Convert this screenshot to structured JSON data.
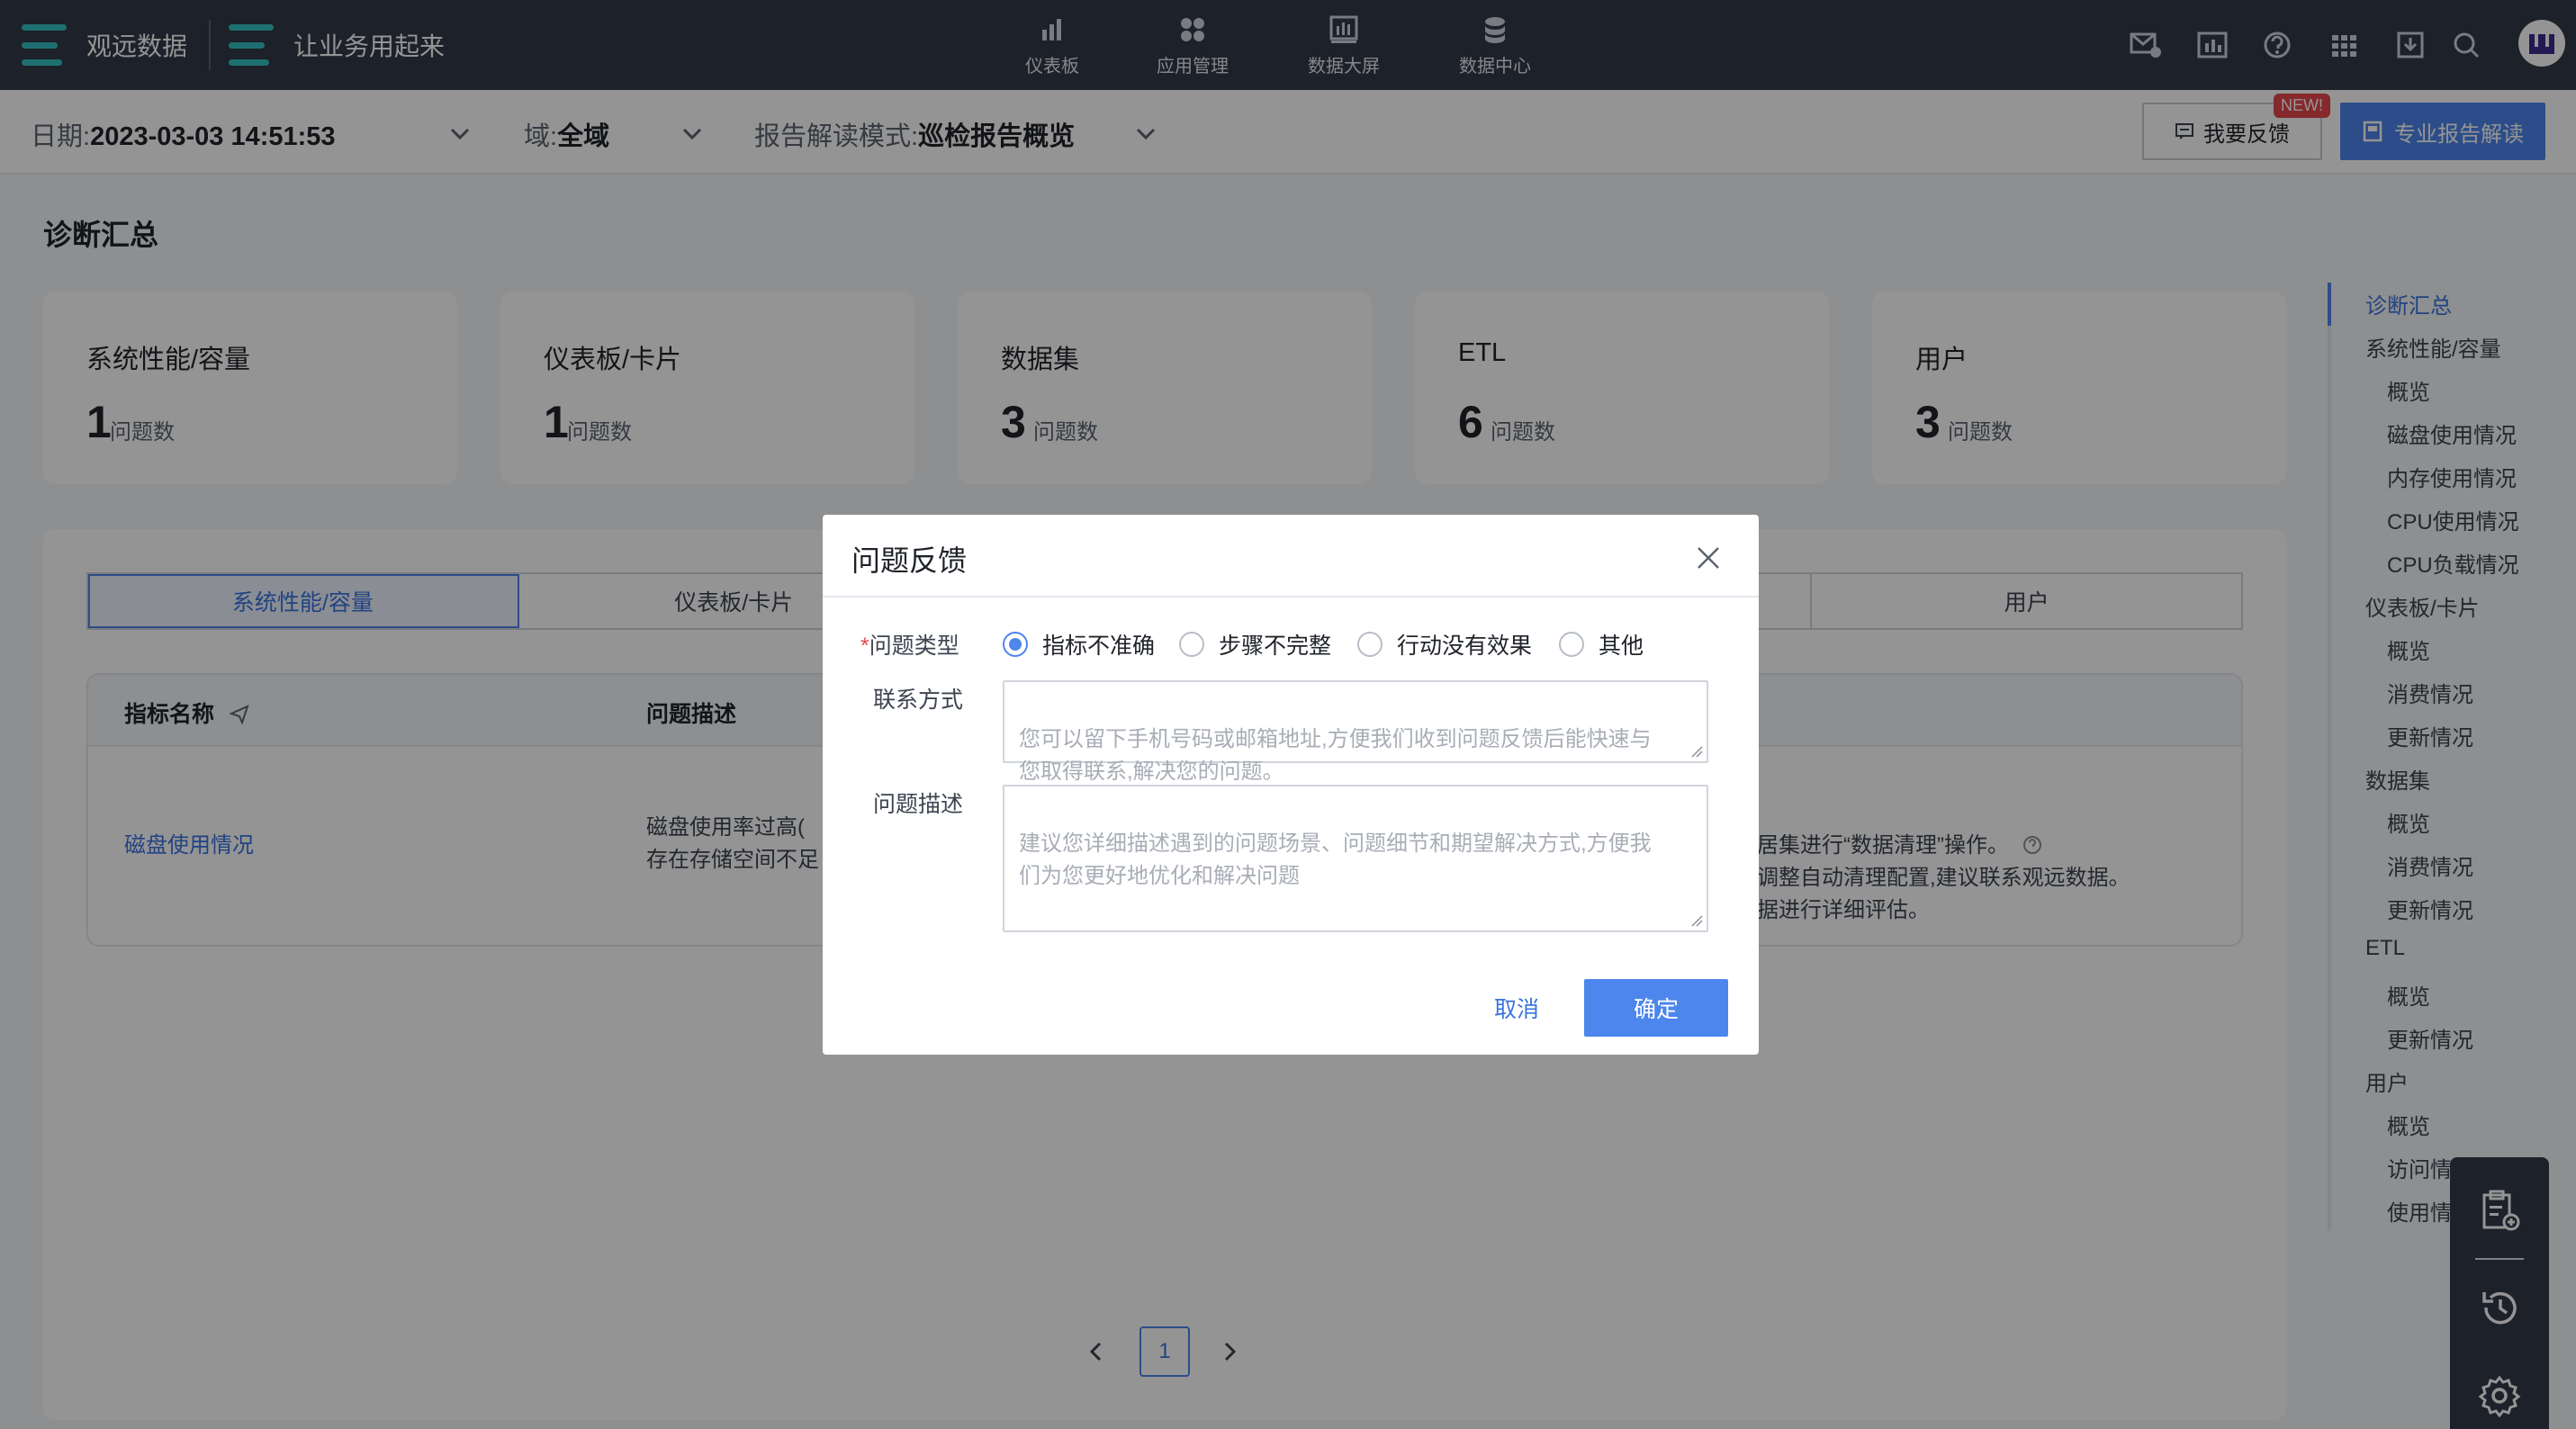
{
  "brand": {
    "name": "观远数据",
    "slogan": "让业务用起来"
  },
  "nav": {
    "items": [
      {
        "label": "仪表板",
        "icon": "bar-chart-icon"
      },
      {
        "label": "应用管理",
        "icon": "apps-icon"
      },
      {
        "label": "数据大屏",
        "icon": "screen-icon"
      },
      {
        "label": "数据中心",
        "icon": "database-icon"
      }
    ],
    "tools": [
      "mail-settings-icon",
      "report-icon",
      "help-icon",
      "grid-icon",
      "download-icon",
      "search-icon"
    ]
  },
  "filter": {
    "date_label": "日期:",
    "date_value": "2023-03-03 14:51:53",
    "domain_label": "域:",
    "domain_value": "全域",
    "mode_label": "报告解读模式:",
    "mode_value": "巡检报告概览",
    "feedback_button": "我要反馈",
    "new_badge": "NEW!",
    "pro_button": "专业报告解读"
  },
  "summary": {
    "title": "诊断汇总",
    "unit": "问题数",
    "cards": [
      {
        "title": "系统性能/容量",
        "value": "1"
      },
      {
        "title": "仪表板/卡片",
        "value": "1"
      },
      {
        "title": "数据集",
        "value": "3"
      },
      {
        "title": "ETL",
        "value": "6"
      },
      {
        "title": "用户",
        "value": "3"
      }
    ]
  },
  "tabs": [
    "系统性能/容量",
    "仪表板/卡片",
    "",
    "",
    "用户"
  ],
  "table": {
    "headers": {
      "metric": "指标名称",
      "desc": "问题描述"
    },
    "row": {
      "metric": "磁盘使用情况",
      "desc_line1": "磁盘使用率过高(",
      "desc_line2": "存在存储空间不足",
      "sugg_line1": "居集进行“数据清理”操作。",
      "sugg_line2": "调整自动清理配置,建议联系观远数据。",
      "sugg_line3": "据进行详细评估。"
    }
  },
  "pager": {
    "current": "1"
  },
  "anchors": [
    {
      "label": "诊断汇总",
      "level": 0,
      "active": true
    },
    {
      "label": "系统性能/容量",
      "level": 0
    },
    {
      "label": "概览",
      "level": 1
    },
    {
      "label": "磁盘使用情况",
      "level": 1
    },
    {
      "label": "内存使用情况",
      "level": 1
    },
    {
      "label": "CPU使用情况",
      "level": 1
    },
    {
      "label": "CPU负载情况",
      "level": 1
    },
    {
      "label": "仪表板/卡片",
      "level": 0
    },
    {
      "label": "概览",
      "level": 1
    },
    {
      "label": "消费情况",
      "level": 1
    },
    {
      "label": "更新情况",
      "level": 1
    },
    {
      "label": "数据集",
      "level": 0
    },
    {
      "label": "概览",
      "level": 1
    },
    {
      "label": "消费情况",
      "level": 1
    },
    {
      "label": "更新情况",
      "level": 1
    },
    {
      "label": "ETL",
      "level": 0
    },
    {
      "label": "概览",
      "level": 1
    },
    {
      "label": "更新情况",
      "level": 1
    },
    {
      "label": "用户",
      "level": 0
    },
    {
      "label": "概览",
      "level": 1
    },
    {
      "label": "访问情",
      "level": 1
    },
    {
      "label": "使用情",
      "level": 1
    }
  ],
  "modal": {
    "title": "问题反馈",
    "type_label": "问题类型",
    "options": [
      "指标不准确",
      "步骤不完整",
      "行动没有效果",
      "其他"
    ],
    "selected": 0,
    "contact_label": "联系方式",
    "contact_placeholder": "您可以留下手机号码或邮箱地址,方便我们收到问题反馈后能快速与\n您取得联系,解决您的问题。",
    "desc_label": "问题描述",
    "desc_placeholder": "建议您详细描述遇到的问题场景、问题细节和期望解决方式,方便我\n们为您更好地优化和解决问题",
    "cancel": "取消",
    "confirm": "确定"
  },
  "colors": {
    "nav_bg": "#313949",
    "primary": "#4d86ec",
    "brand_teal": "#35c2c1",
    "badge_red": "#e5484d"
  }
}
